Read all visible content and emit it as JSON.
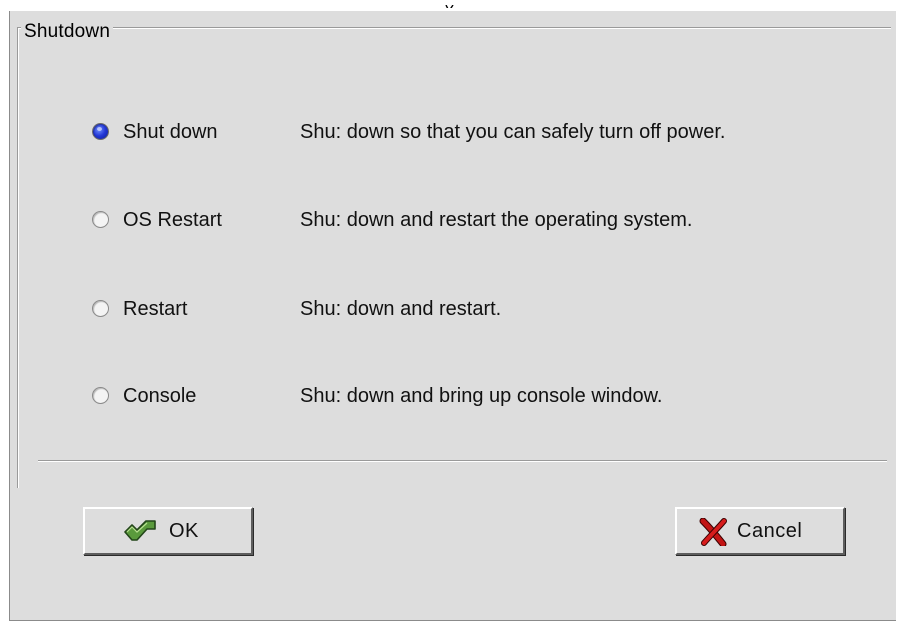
{
  "group": {
    "title": "Shutdown"
  },
  "options": [
    {
      "label": "Shut down",
      "description": "Shu: down so that you can safely turn off power.",
      "selected": true
    },
    {
      "label": "OS Restart",
      "description": "Shu: down and restart the operating system.",
      "selected": false
    },
    {
      "label": "Restart",
      "description": "Shu: down and restart.",
      "selected": false
    },
    {
      "label": "Console",
      "description": "Shu: down and bring up console window.",
      "selected": false
    }
  ],
  "buttons": {
    "ok_label": "OK",
    "cancel_label": "Cancel"
  },
  "icons": {
    "ok": "check-arrow-icon",
    "cancel": "x-mark-icon"
  },
  "colors": {
    "dialog_background": "#dddddd",
    "radio_selected": "#2438d6",
    "cancel_icon": "#b81010",
    "ok_icon": "#5a9a3c"
  }
}
